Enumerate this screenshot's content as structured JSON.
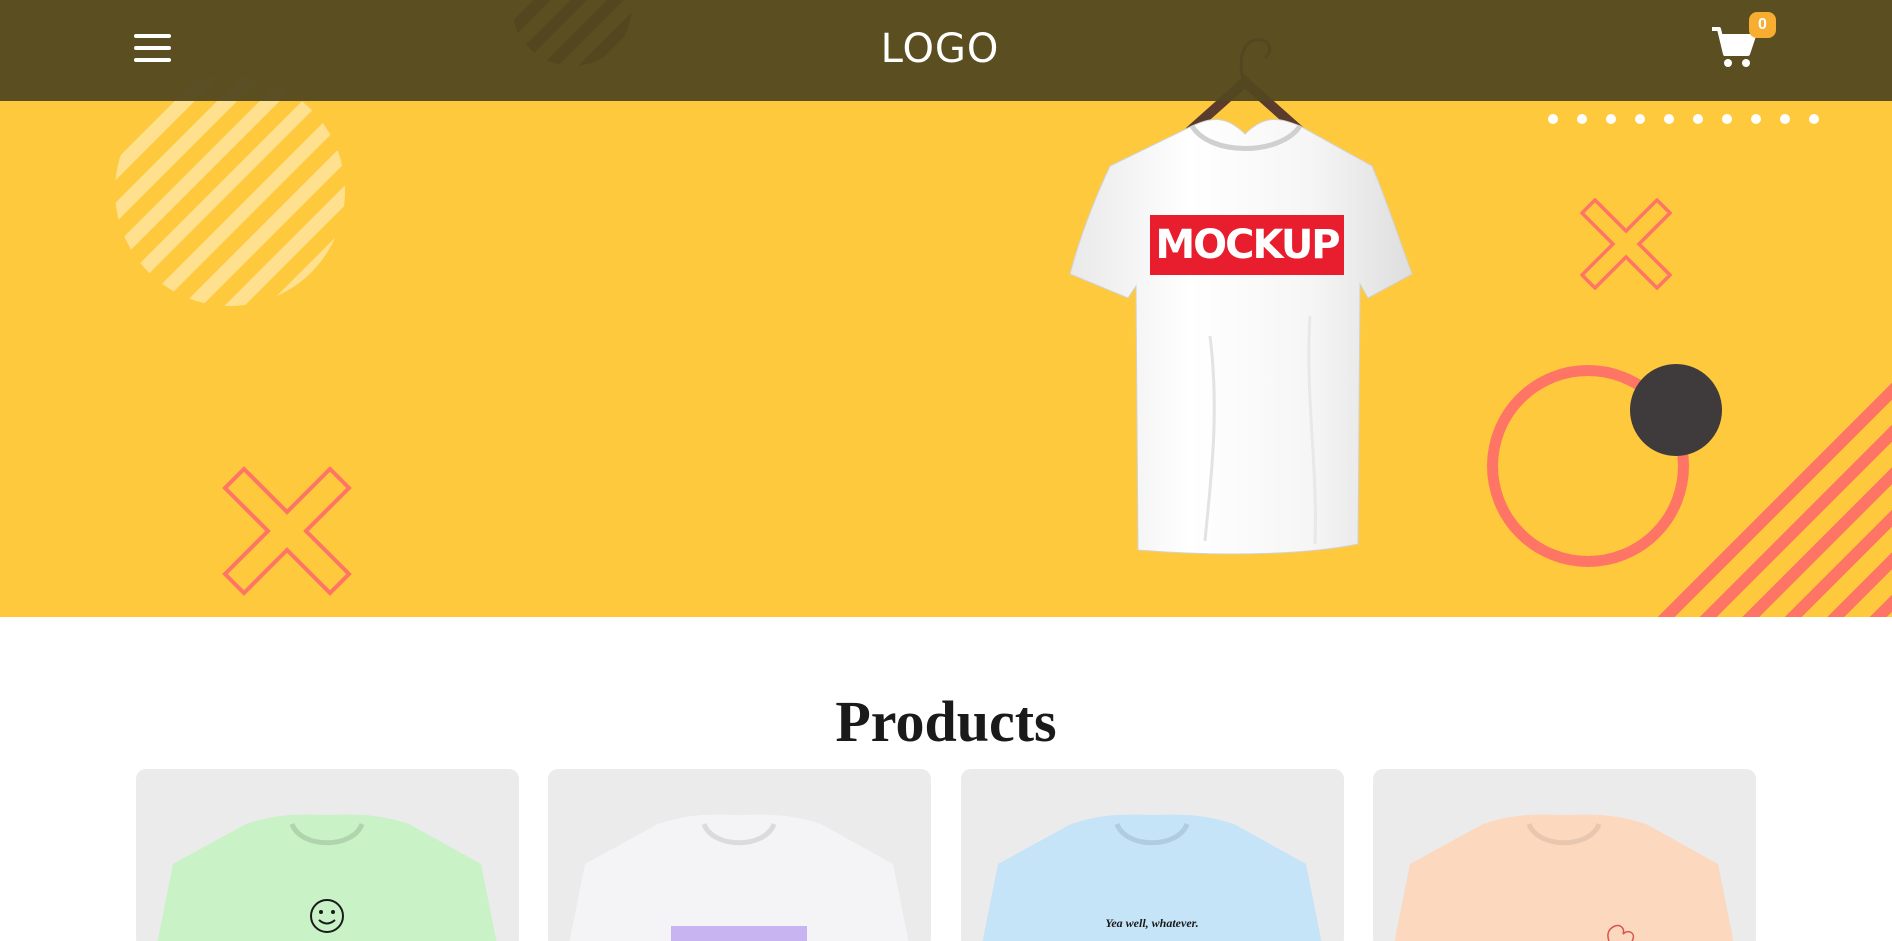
{
  "header": {
    "logo": "LOGO",
    "menu_icon": "hamburger-menu-icon",
    "cart_icon": "shopping-cart-icon",
    "cart_count": "0"
  },
  "hero": {
    "shirt_print": "MOCKUP",
    "colors": {
      "background": "#fec93d",
      "accent": "#fe7566",
      "dark": "#3f3a3b",
      "print": "#e81d2d"
    }
  },
  "products": {
    "title": "Products",
    "items": [
      {
        "color": "#c9f2c7",
        "print": "smiley-face"
      },
      {
        "color": "#f4f4f7",
        "print": "lavender-block"
      },
      {
        "color": "#c5e4f8",
        "print": "Yea well, whatever."
      },
      {
        "color": "#fcd8bf",
        "print": "heart-sketch"
      }
    ]
  }
}
